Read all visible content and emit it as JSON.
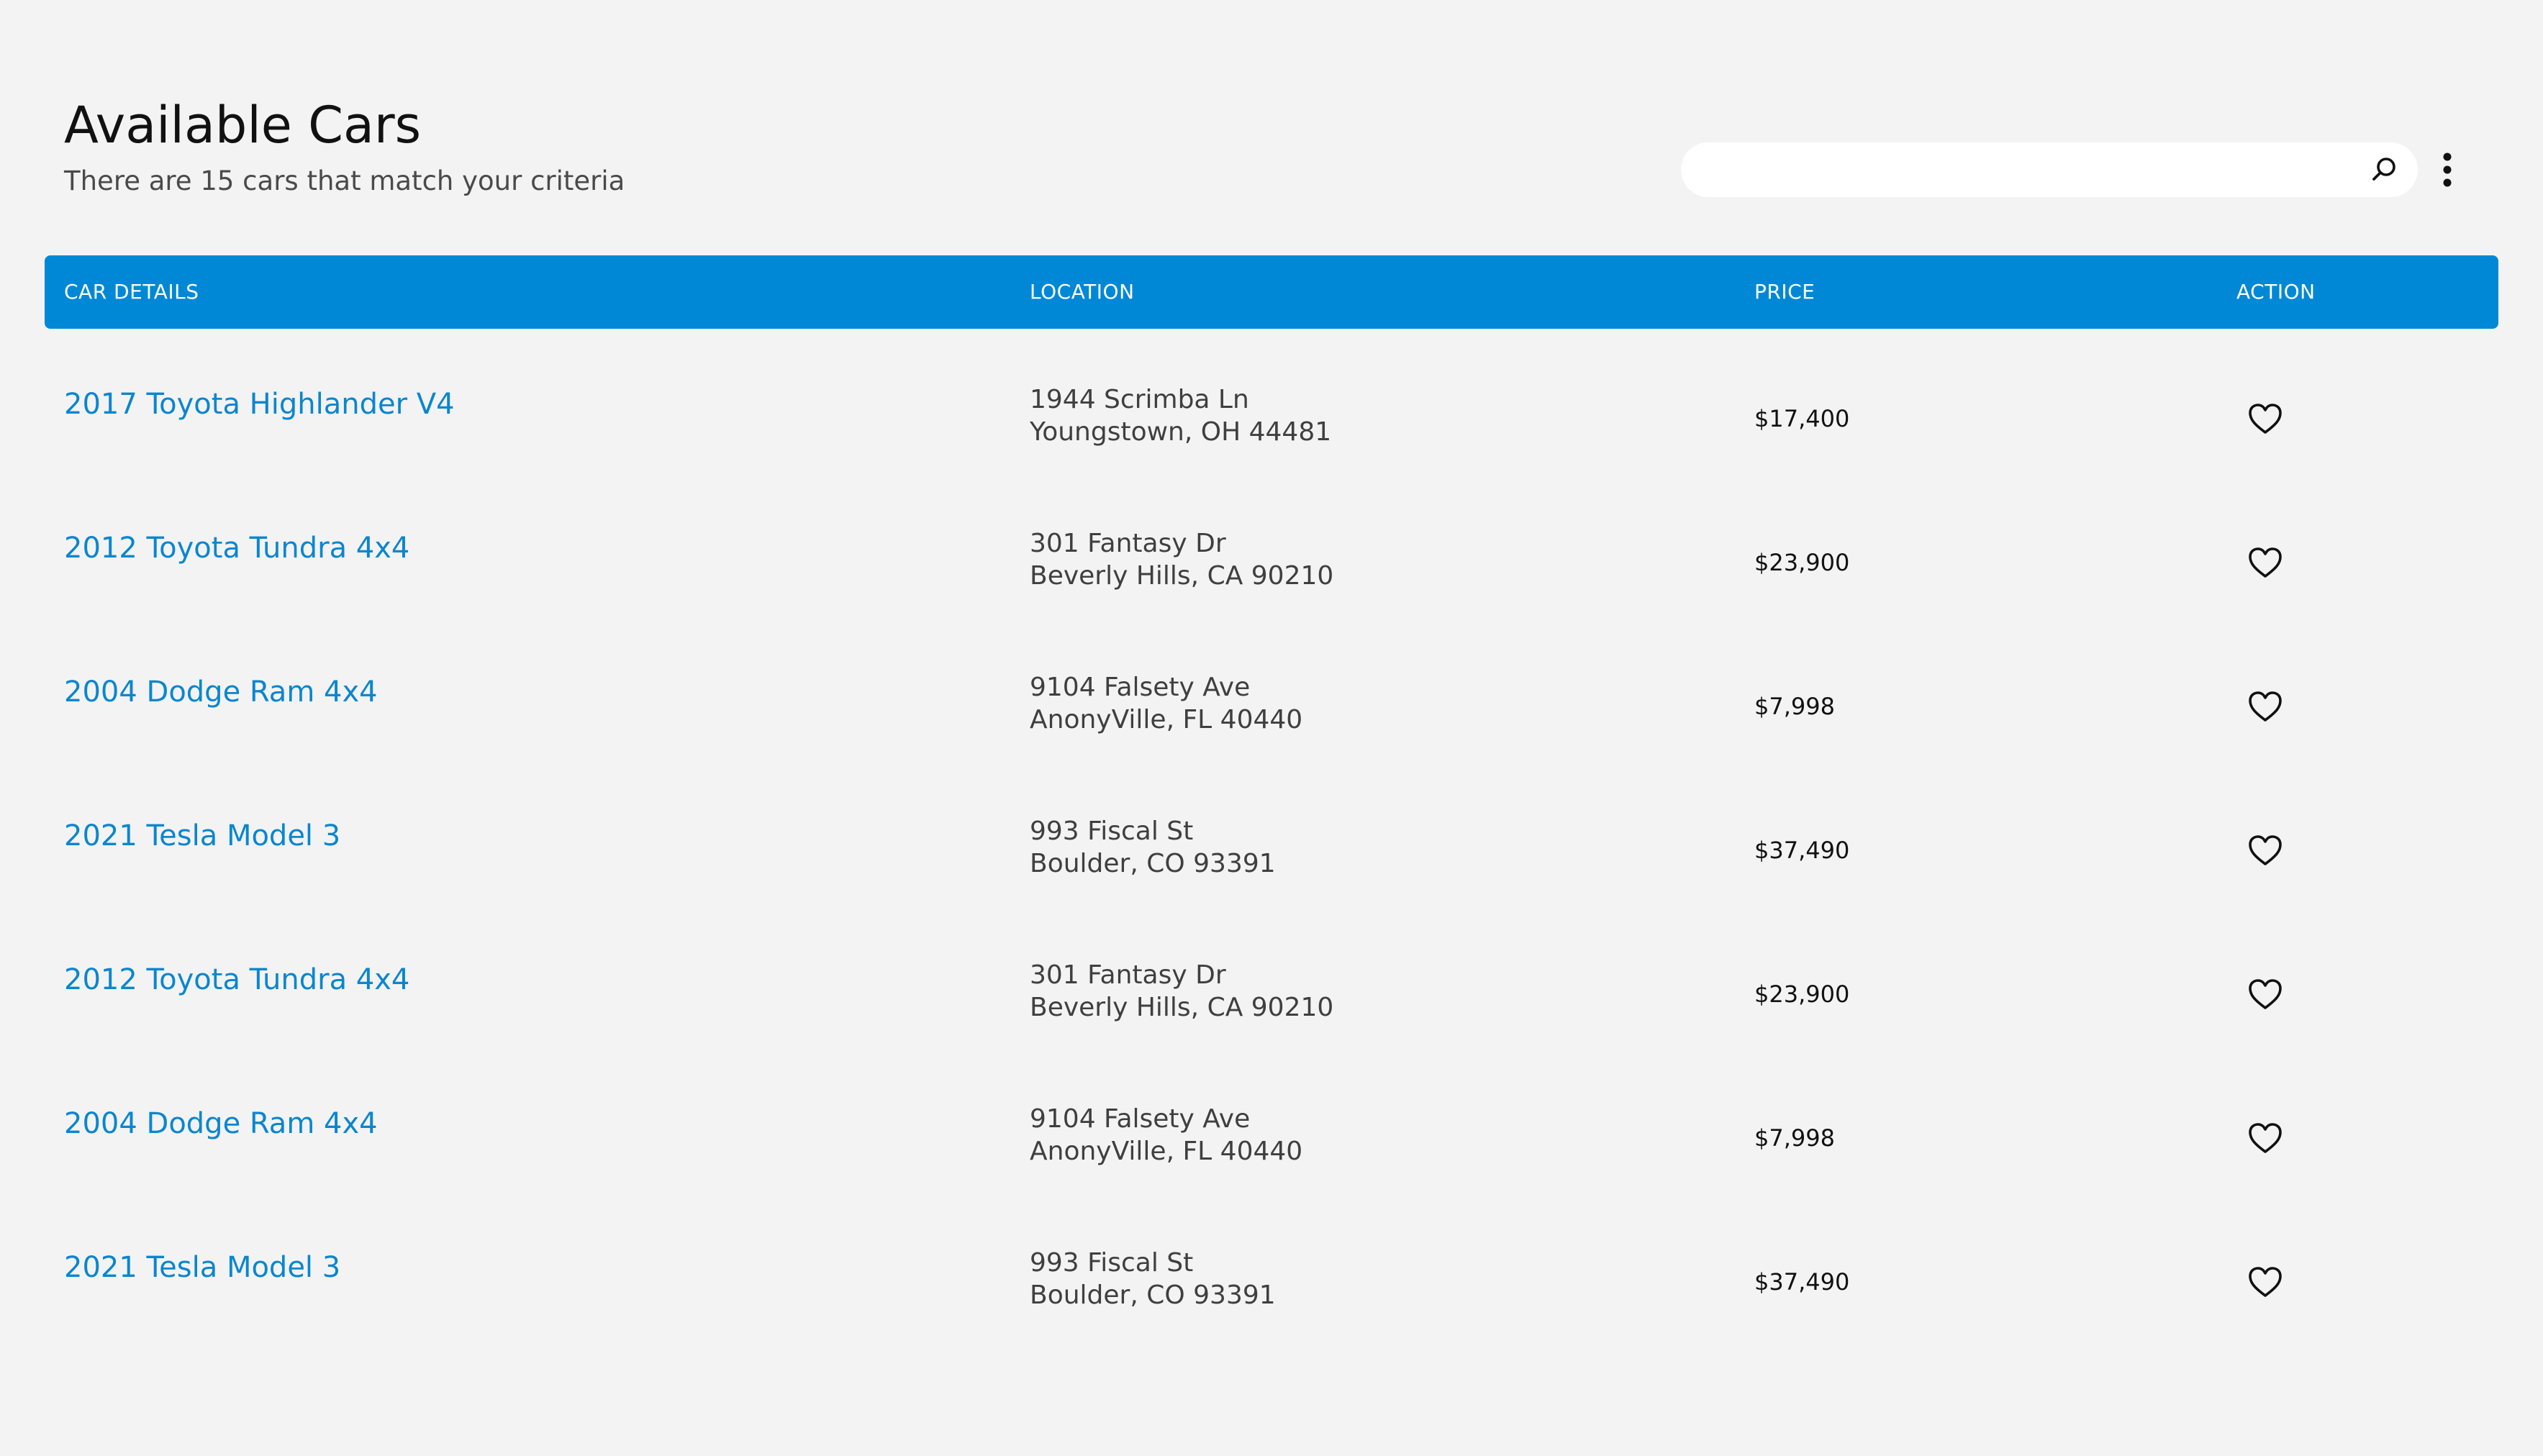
{
  "header": {
    "title": "Available Cars",
    "subtitle": "There are 15 cars that match your criteria"
  },
  "search": {
    "placeholder": "",
    "value": "",
    "icon": "search-icon"
  },
  "menu": {
    "icon": "more-vertical-icon"
  },
  "table": {
    "columns": [
      "CAR DETAILS",
      "LOCATION",
      "PRICE",
      "ACTION"
    ],
    "rows": [
      {
        "name": "2017 Toyota Highlander V4",
        "address": "1944 Scrimba Ln",
        "city": "Youngstown, OH 44481",
        "price": "$17,400"
      },
      {
        "name": "2012 Toyota Tundra 4x4",
        "address": "301 Fantasy Dr",
        "city": "Beverly Hills, CA 90210",
        "price": "$23,900"
      },
      {
        "name": "2004 Dodge Ram 4x4",
        "address": "9104 Falsety Ave",
        "city": "AnonyVille, FL 40440",
        "price": "$7,998"
      },
      {
        "name": "2021 Tesla Model 3",
        "address": "993 Fiscal St",
        "city": "Boulder, CO 93391",
        "price": "$37,490"
      },
      {
        "name": "2012 Toyota Tundra 4x4",
        "address": "301 Fantasy Dr",
        "city": "Beverly Hills, CA 90210",
        "price": "$23,900"
      },
      {
        "name": "2004 Dodge Ram 4x4",
        "address": "9104 Falsety Ave",
        "city": "AnonyVille, FL 40440",
        "price": "$7,998"
      },
      {
        "name": "2021 Tesla Model 3",
        "address": "993 Fiscal St",
        "city": "Boulder, CO 93391",
        "price": "$37,490"
      }
    ],
    "action_icon": "heart-icon"
  },
  "colors": {
    "background": "#f3f3f4",
    "header_bar": "#0088d6",
    "link": "#0a86cf"
  }
}
